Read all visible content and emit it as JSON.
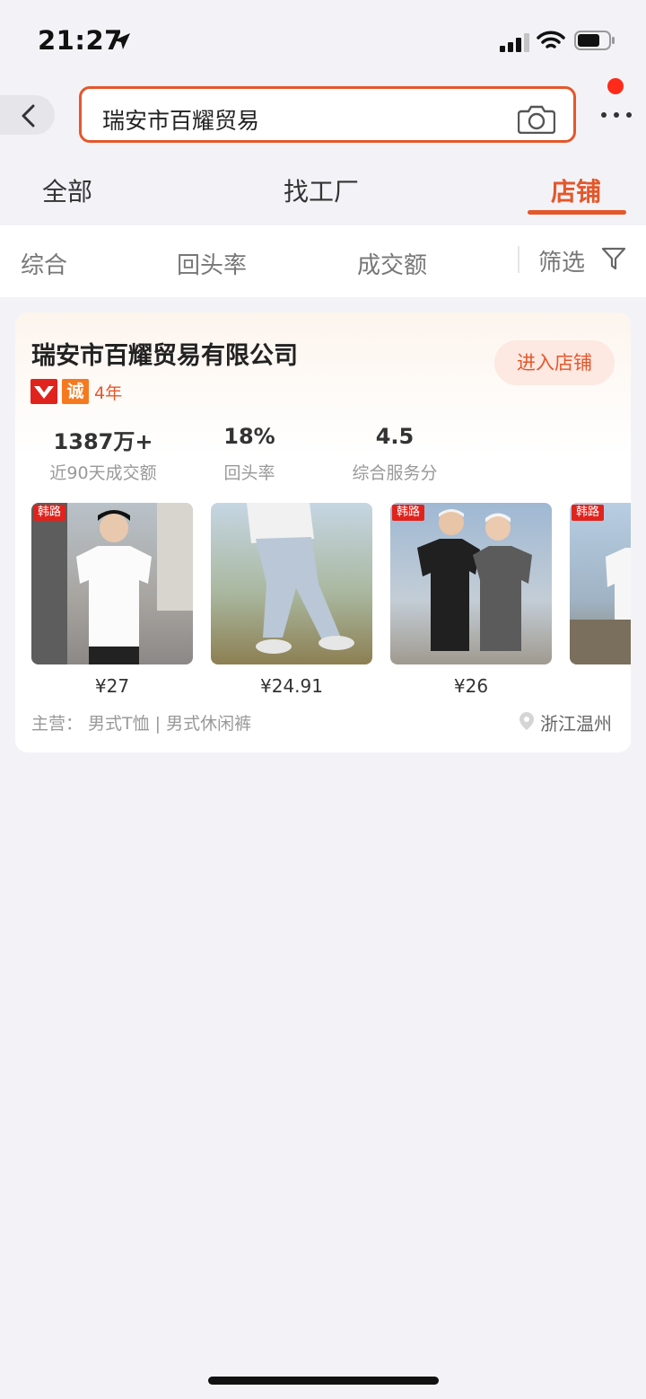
{
  "status": {
    "time": "21:27"
  },
  "search": {
    "query": "瑞安市百耀贸易"
  },
  "tabs": [
    {
      "label": "全部"
    },
    {
      "label": "找工厂"
    },
    {
      "label": "店铺"
    }
  ],
  "filters": [
    {
      "label": "综合"
    },
    {
      "label": "回头率"
    },
    {
      "label": "成交额"
    },
    {
      "label": "筛选"
    }
  ],
  "store": {
    "name": "瑞安市百耀贸易有限公司",
    "enter_label": "进入店铺",
    "badge_cheng": "诚",
    "years": "4年",
    "stats": [
      {
        "value": "1387万+",
        "label": "近90天成交额"
      },
      {
        "value": "18%",
        "label": "回头率"
      },
      {
        "value": "4.5",
        "label": "综合服务分"
      }
    ],
    "products": [
      {
        "tag": "韩路",
        "price": "¥27"
      },
      {
        "price": "¥24.91"
      },
      {
        "tag": "韩路",
        "price": "¥26"
      },
      {
        "tag": "韩路"
      }
    ],
    "main_business": "主营： 男式T恤 | 男式休闲裤",
    "location": "浙江温州"
  },
  "colors": {
    "accent": "#e4572a",
    "badge_red": "#e0231d",
    "badge_orange": "#f57a1f"
  }
}
